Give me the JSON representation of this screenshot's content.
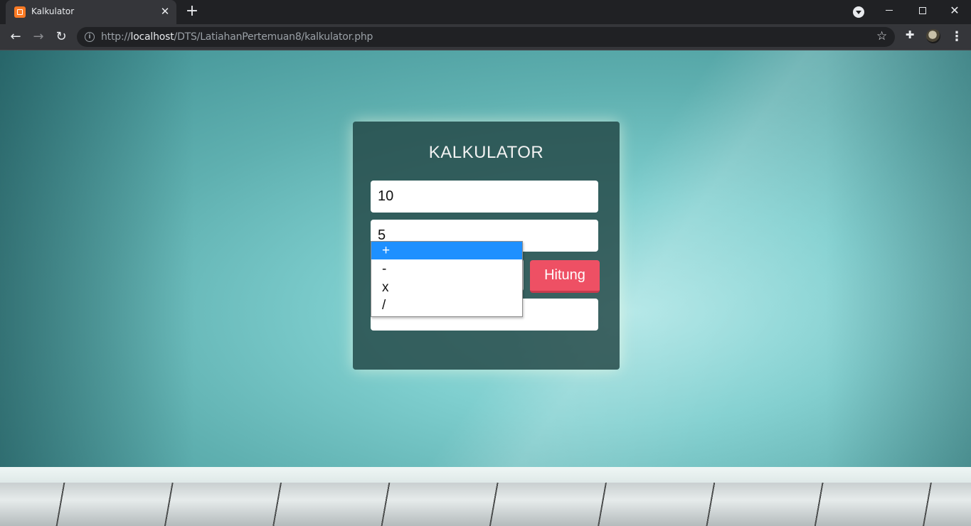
{
  "browser": {
    "tab": {
      "title": "Kalkulator",
      "favicon": "xampp-icon",
      "close_glyph": "✕"
    },
    "new_tab_glyph": "+",
    "url": {
      "scheme": "http://",
      "host": "localhost",
      "path": "/DTS/LatiahanPertemuan8/kalkulator.php"
    },
    "icons": [
      "tab-search-icon",
      "back-icon",
      "forward-icon",
      "reload-icon",
      "info-icon",
      "star-icon",
      "extensions-icon",
      "avatar",
      "more-menu-icon",
      "minimize-icon",
      "restore-icon",
      "close-icon"
    ]
  },
  "calculator": {
    "title": "KALKULATOR",
    "first_number": "10",
    "second_number": "5",
    "operator_selected": "+",
    "operator_options": [
      "+",
      "-",
      "x",
      "/"
    ],
    "submit_label": "Hitung",
    "result_value": "",
    "colors": {
      "card": "#224644",
      "button": "#ee5064",
      "selected_option": "#1e90ff"
    }
  }
}
